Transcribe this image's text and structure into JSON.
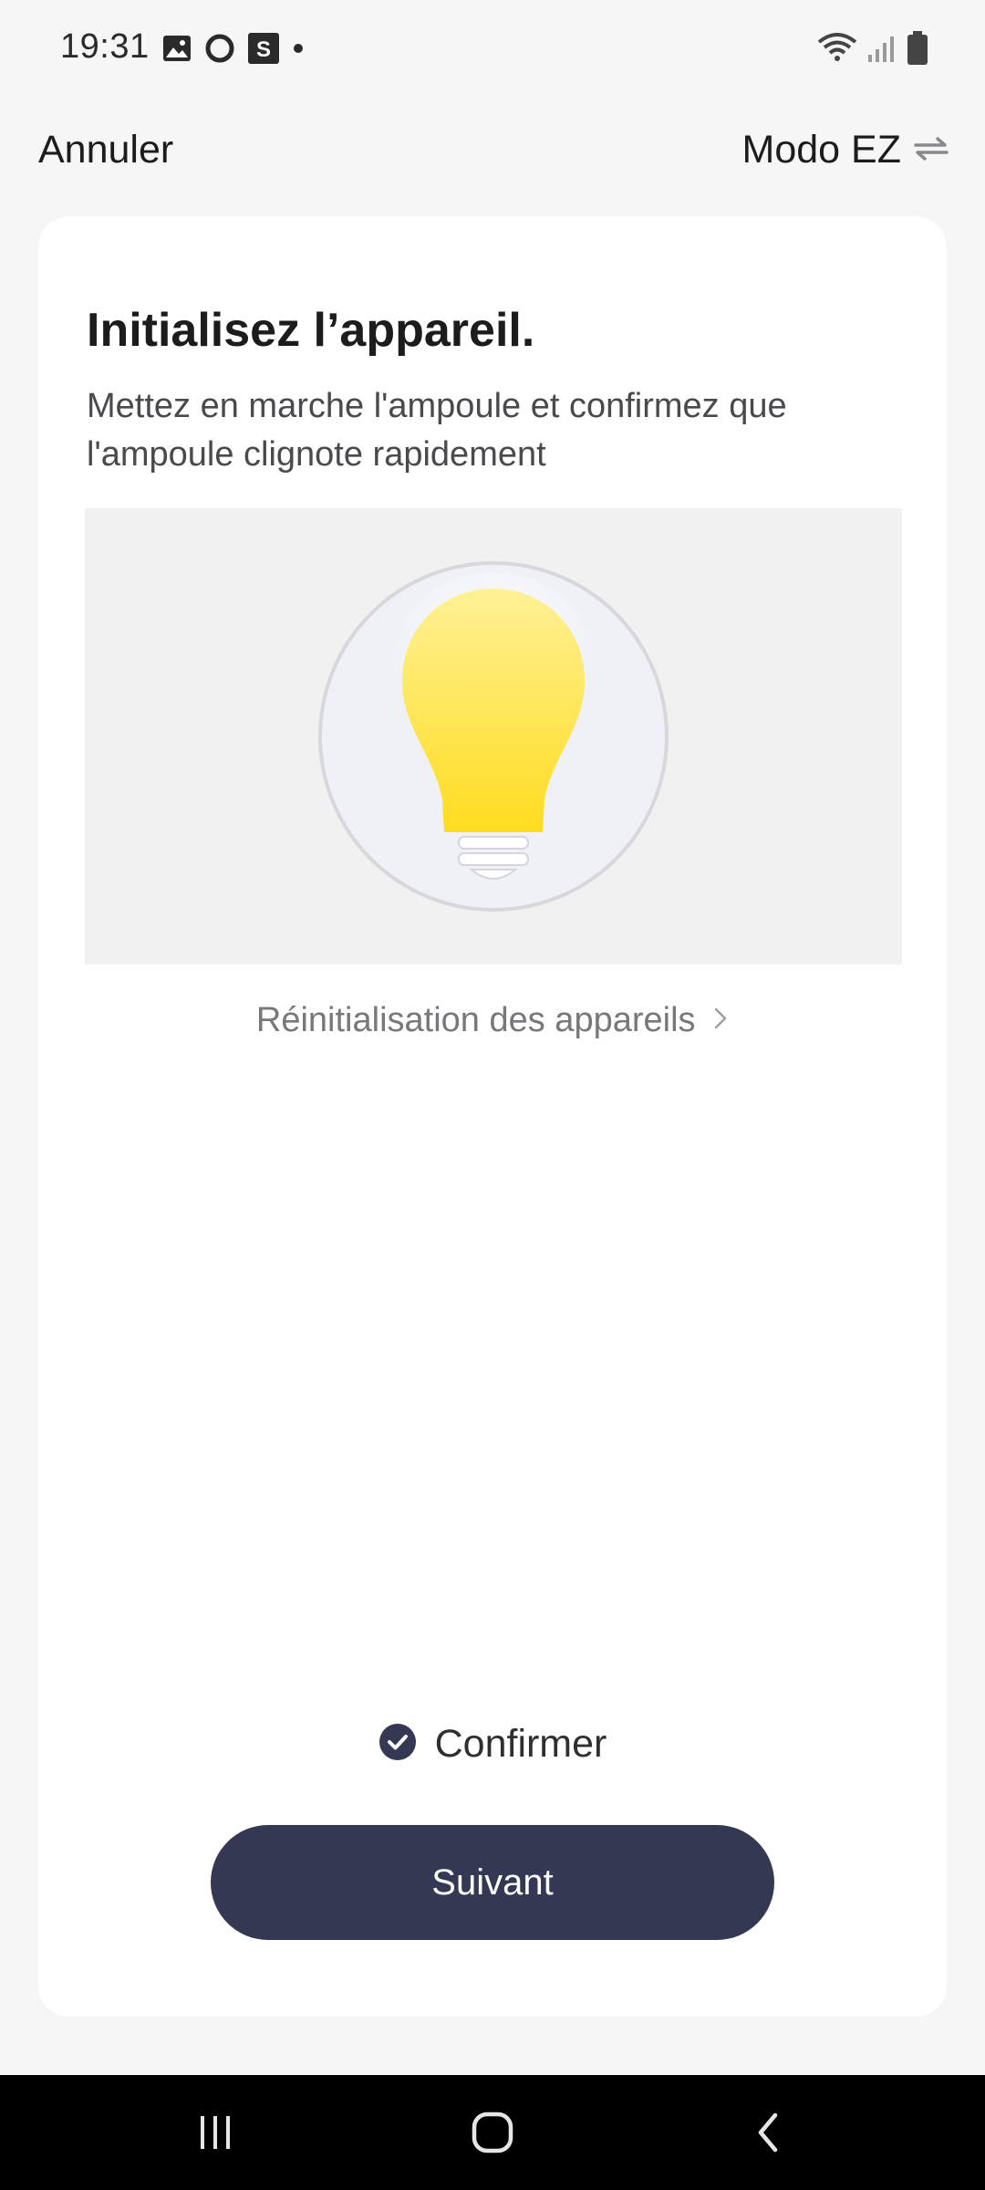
{
  "status_bar": {
    "time": "19:31",
    "left_icons": [
      "gallery-icon",
      "circle-app-icon",
      "s-app-icon",
      "dot-icon"
    ],
    "right_icons": [
      "wifi-icon",
      "signal-icon",
      "battery-icon"
    ]
  },
  "nav": {
    "cancel_label": "Annuler",
    "mode_label": "Modo EZ",
    "mode_icon": "swap-arrows-icon"
  },
  "card": {
    "title": "Initialisez l’appareil.",
    "description": "Mettez en marche l'ampoule et confirmez que l'ampoule clignote rapidement",
    "illustration_icon": "light-bulb-icon",
    "reset_link_label": "Réinitialisation des appareils",
    "reset_link_icon": "chevron-right-icon",
    "confirm_label": "Confirmer",
    "confirm_checked": true,
    "next_button_label": "Suivant"
  },
  "colors": {
    "background": "#f6f6f7",
    "card": "#ffffff",
    "primary_button": "#353852",
    "bulb_yellow": "#ffe033",
    "link_gray": "#77777c"
  },
  "android_nav": {
    "icons": [
      "recent-apps-icon",
      "home-icon",
      "back-icon"
    ]
  }
}
